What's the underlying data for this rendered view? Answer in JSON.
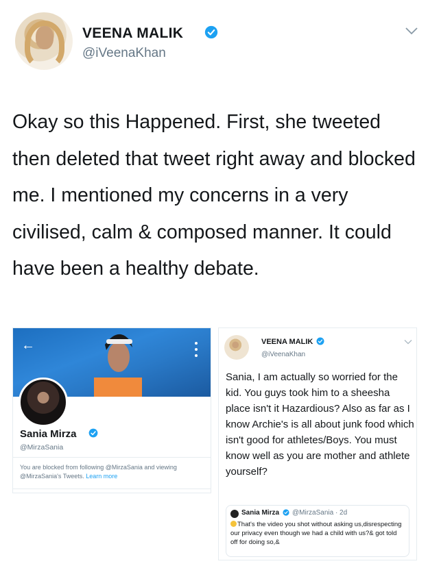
{
  "tweet": {
    "author_name": "VEENA MALIK",
    "author_handle": "@iVeenaKhan",
    "text": "Okay so this Happened. First, she tweeted then deleted that tweet right away and blocked me. I mentioned my concerns in a very civilised, calm & composed manner. It could have been a healthy debate."
  },
  "profile_card": {
    "name": "Sania Mirza",
    "handle": "@MirzaSania",
    "blocked_text": "You are blocked from following @MirzaSania and viewing @MirzaSania's Tweets.",
    "learn_more": "Learn more"
  },
  "embedded_tweet": {
    "author_name": "VEENA MALIK",
    "author_handle": "@iVeenaKhan",
    "text": "Sania, I am actually so worried for the kid. You guys took him to a sheesha place isn't it Hazardious? Also as far as I know Archie's is all about junk food which isn't good for athletes/Boys. You must know well as you are mother and athlete yourself?",
    "quoted": {
      "name": "Sania Mirza",
      "handle_time": "@MirzaSania · 2d",
      "text": "That's the video you shot without asking us,disrespecting our privacy even though we had a child with us?& got told off for doing so,&"
    }
  },
  "icons": {
    "verified": "verified-badge-icon",
    "chevron": "chevron-down-icon",
    "back": "back-arrow-icon",
    "more": "more-vertical-icon"
  },
  "colors": {
    "accent": "#1da1f2",
    "secondary_text": "#657786",
    "banner": "#2a7ac8"
  }
}
